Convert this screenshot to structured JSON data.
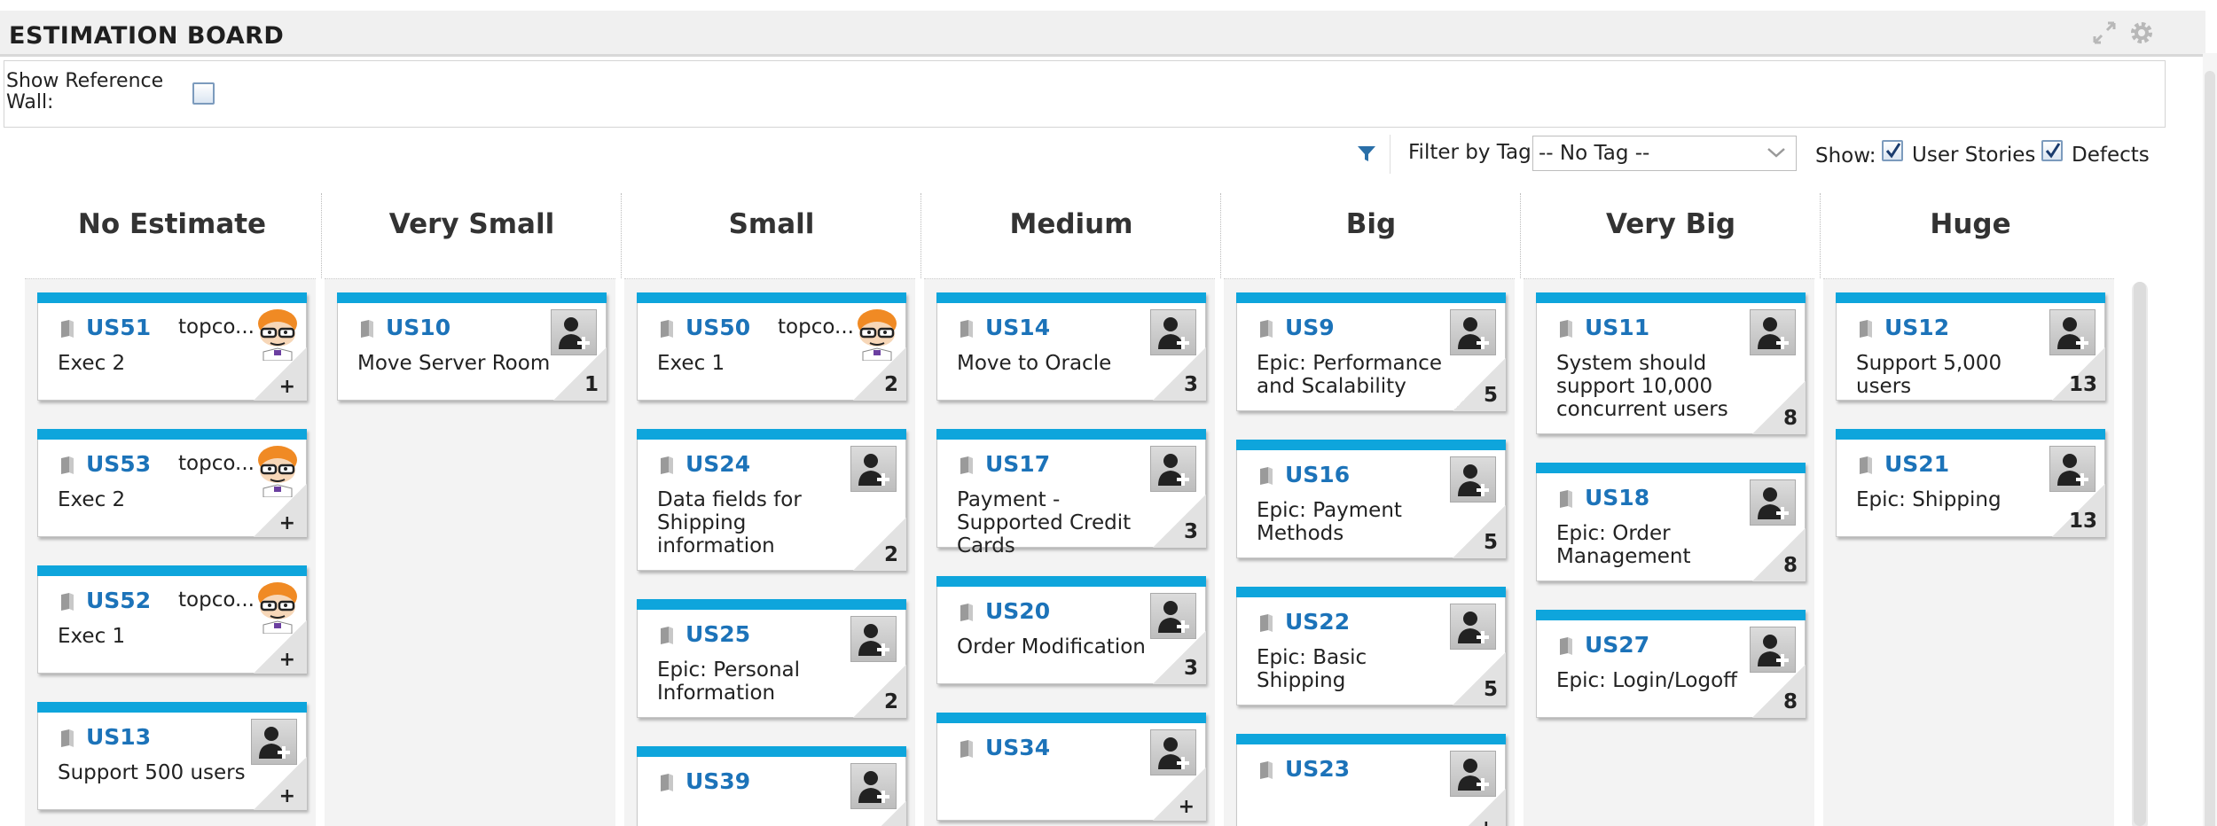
{
  "board": {
    "title": "ESTIMATION BOARD"
  },
  "settings": {
    "show_reference_wall_label": "Show Reference Wall:",
    "show_reference_wall_checked": false
  },
  "filter": {
    "filter_by_tag_label": "Filter by Tag:",
    "tag_value": "-- No Tag --",
    "show_label": "Show:",
    "user_stories_label": "User Stories",
    "user_stories_checked": true,
    "defects_label": "Defects",
    "defects_checked": true
  },
  "colors": {
    "card_bar": "#0ea5dc",
    "id_link": "#1c73b9"
  },
  "columns": [
    {
      "title": "No Estimate",
      "cards": [
        {
          "id": "US51",
          "name": "Exec 2",
          "owner": "topco...",
          "estimate": "",
          "avatar": "dexter"
        },
        {
          "id": "US53",
          "name": "Exec 2",
          "owner": "topco...",
          "estimate": "",
          "avatar": "dexter"
        },
        {
          "id": "US52",
          "name": "Exec 1",
          "owner": "topco...",
          "estimate": "",
          "avatar": "dexter"
        },
        {
          "id": "US13",
          "name": "Support 500 users",
          "owner": "",
          "estimate": "",
          "avatar": "none"
        }
      ]
    },
    {
      "title": "Very Small",
      "cards": [
        {
          "id": "US10",
          "name": "Move Server Room",
          "owner": "",
          "estimate": "1",
          "avatar": "none"
        }
      ]
    },
    {
      "title": "Small",
      "cards": [
        {
          "id": "US50",
          "name": "Exec 1",
          "owner": "topco...",
          "estimate": "2",
          "avatar": "dexter"
        },
        {
          "id": "US24",
          "name": "Data fields for Shipping information",
          "owner": "",
          "estimate": "2",
          "avatar": "none"
        },
        {
          "id": "US25",
          "name": "Epic: Personal Information",
          "owner": "",
          "estimate": "2",
          "avatar": "none"
        },
        {
          "id": "US39",
          "name": "",
          "owner": "",
          "estimate": "",
          "avatar": "none"
        }
      ]
    },
    {
      "title": "Medium",
      "cards": [
        {
          "id": "US14",
          "name": "Move to Oracle",
          "owner": "",
          "estimate": "3",
          "avatar": "none"
        },
        {
          "id": "US17",
          "name": "Payment - Supported Credit Cards",
          "owner": "",
          "estimate": "3",
          "avatar": "none"
        },
        {
          "id": "US20",
          "name": "Order Modification",
          "owner": "",
          "estimate": "3",
          "avatar": "none"
        },
        {
          "id": "US34",
          "name": "",
          "owner": "",
          "estimate": "",
          "avatar": "none"
        }
      ]
    },
    {
      "title": "Big",
      "cards": [
        {
          "id": "US9",
          "name": "Epic: Performance and Scalability",
          "owner": "",
          "estimate": "5",
          "avatar": "none"
        },
        {
          "id": "US16",
          "name": "Epic: Payment Methods",
          "owner": "",
          "estimate": "5",
          "avatar": "none"
        },
        {
          "id": "US22",
          "name": "Epic: Basic Shipping",
          "owner": "",
          "estimate": "5",
          "avatar": "none"
        },
        {
          "id": "US23",
          "name": "",
          "owner": "",
          "estimate": "",
          "avatar": "none"
        }
      ]
    },
    {
      "title": "Very Big",
      "cards": [
        {
          "id": "US11",
          "name": "System should support 10,000 concurrent users",
          "owner": "",
          "estimate": "8",
          "avatar": "none"
        },
        {
          "id": "US18",
          "name": "Epic: Order Management",
          "owner": "",
          "estimate": "8",
          "avatar": "none"
        },
        {
          "id": "US27",
          "name": "Epic: Login/Logoff",
          "owner": "",
          "estimate": "8",
          "avatar": "none"
        }
      ]
    },
    {
      "title": "Huge",
      "cards": [
        {
          "id": "US12",
          "name": "Support 5,000 users",
          "owner": "",
          "estimate": "13",
          "avatar": "none"
        },
        {
          "id": "US21",
          "name": "Epic: Shipping",
          "owner": "",
          "estimate": "13",
          "avatar": "none"
        }
      ]
    }
  ]
}
